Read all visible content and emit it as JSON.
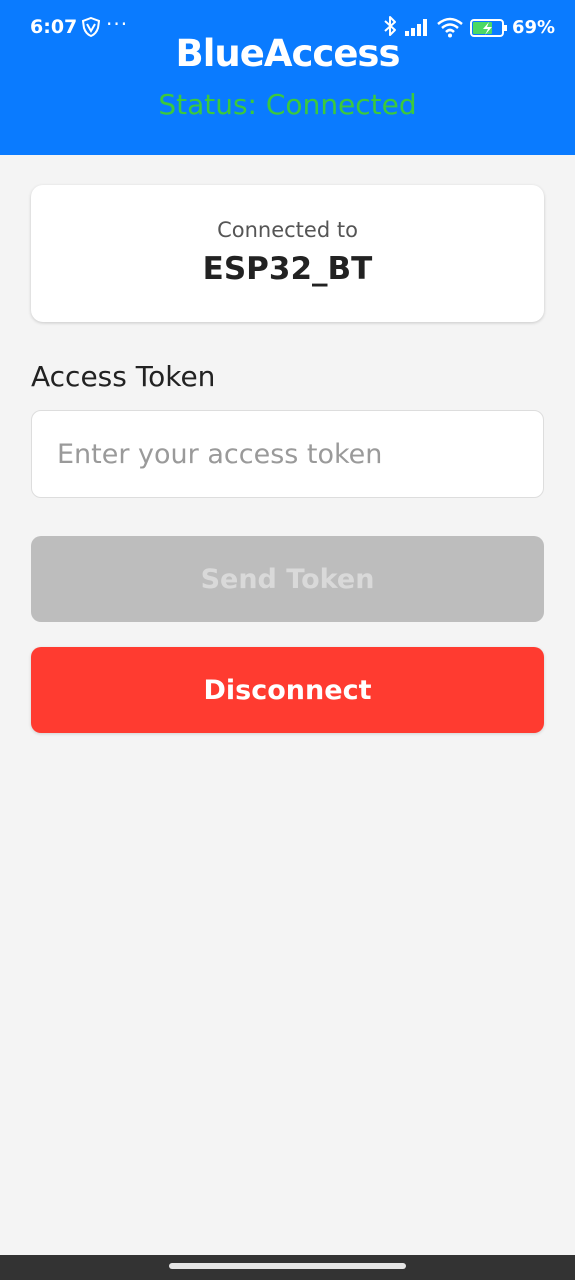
{
  "status_bar": {
    "time": "6:07",
    "more": "···",
    "battery": "69%",
    "icons": [
      "vpn-shield-icon",
      "bluetooth-icon",
      "signal-icon",
      "wifi-icon",
      "battery-charging-icon"
    ],
    "battery_level": 0.69
  },
  "header": {
    "title": "BlueAccess",
    "status": "Status: Connected",
    "status_color": "#3cc93c",
    "background": "#0a7bff"
  },
  "device_card": {
    "label": "Connected to",
    "device_name": "ESP32_BT"
  },
  "token": {
    "label": "Access Token",
    "value": "",
    "placeholder": "Enter your access token"
  },
  "buttons": {
    "send_label": "Send Token",
    "send_color": "#bdbdbd",
    "disconnect_label": "Disconnect",
    "disconnect_color": "#ff3b30"
  }
}
